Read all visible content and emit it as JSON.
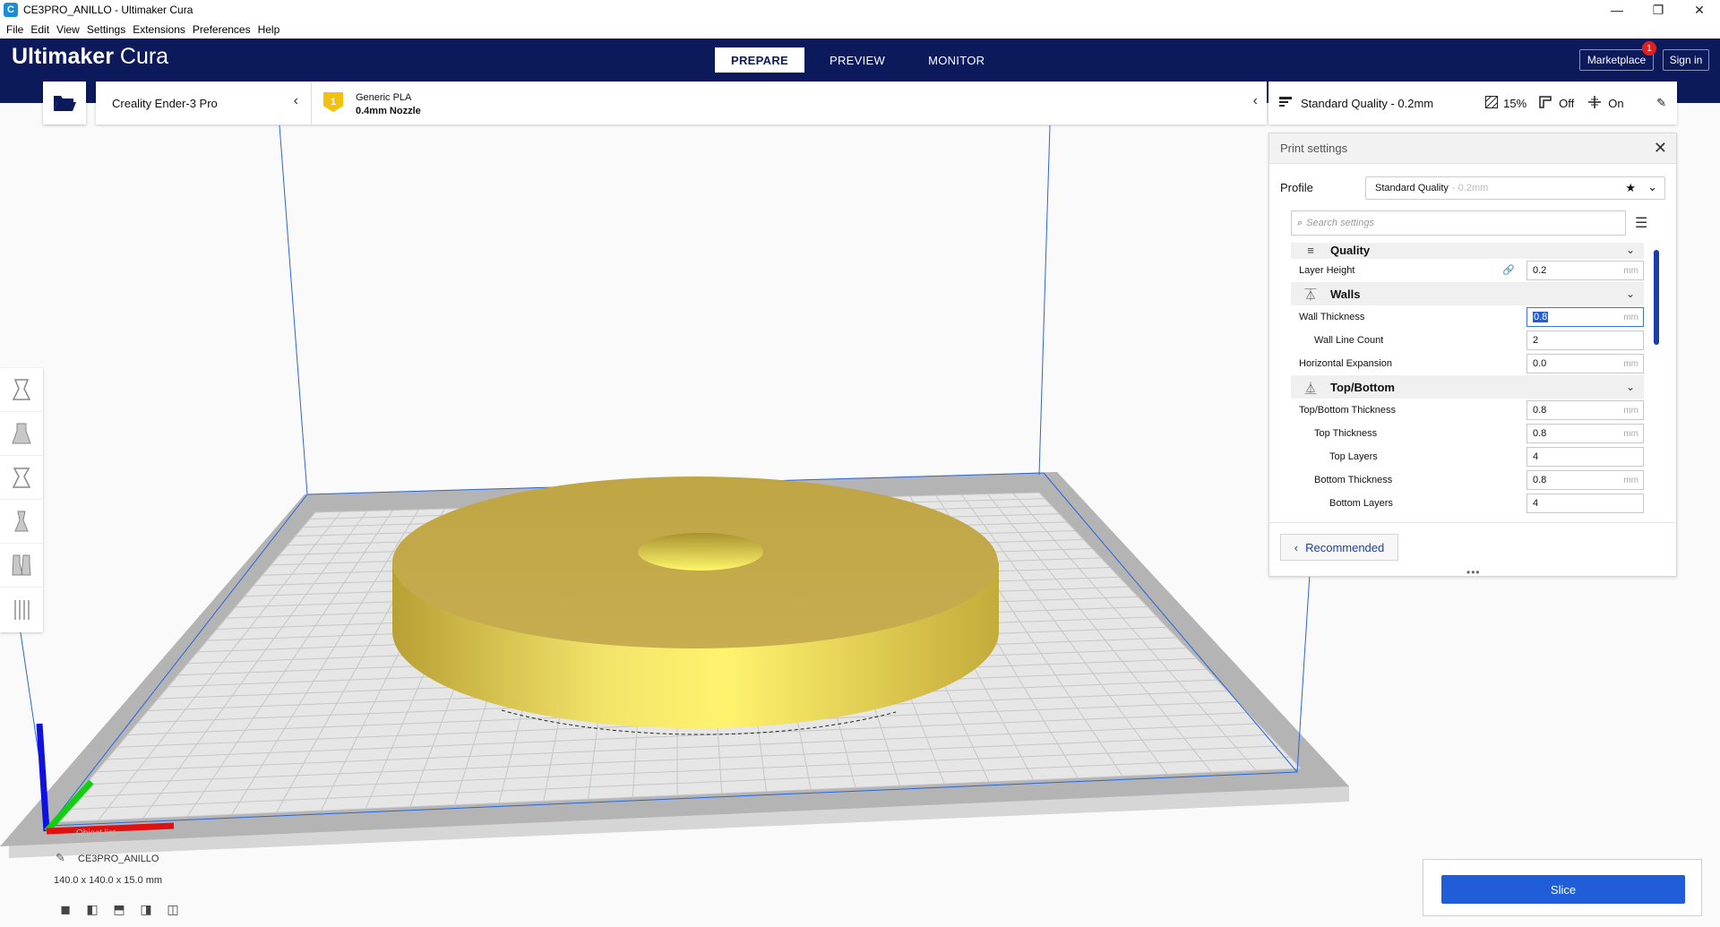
{
  "window": {
    "title": "CE3PRO_ANILLO - Ultimaker Cura",
    "app_icon": "C",
    "minimize": "—",
    "maximize": "❐",
    "close": "✕"
  },
  "menu": [
    "File",
    "Edit",
    "View",
    "Settings",
    "Extensions",
    "Preferences",
    "Help"
  ],
  "header": {
    "brand_bold": "Ultimaker",
    "brand_rest": " Cura",
    "tabs": [
      {
        "label": "PREPARE",
        "active": true
      },
      {
        "label": "PREVIEW",
        "active": false
      },
      {
        "label": "MONITOR",
        "active": false
      }
    ],
    "marketplace": "Marketplace",
    "marketplace_badge": "1",
    "signin": "Sign in"
  },
  "printer": {
    "name": "Creality Ender-3 Pro",
    "material_index": "1",
    "material": "Generic PLA",
    "nozzle": "0.4mm Nozzle"
  },
  "quality_bar": {
    "profile": "Standard Quality - 0.2mm",
    "infill": "15%",
    "support": "Off",
    "adhesion": "On"
  },
  "print_settings": {
    "title": "Print settings",
    "profile_label": "Profile",
    "profile_value": "Standard Quality",
    "profile_dim": "- 0.2mm",
    "search_placeholder": "Search settings",
    "categories": {
      "quality": "Quality",
      "walls": "Walls",
      "topbottom": "Top/Bottom"
    },
    "rows": {
      "layer_height": {
        "label": "Layer Height",
        "value": "0.2",
        "unit": "mm"
      },
      "wall_thickness": {
        "label": "Wall Thickness",
        "value": "0.8",
        "unit": "mm"
      },
      "wall_line_count": {
        "label": "Wall Line Count",
        "value": "2"
      },
      "horizontal_expansion": {
        "label": "Horizontal Expansion",
        "value": "0.0",
        "unit": "mm"
      },
      "topbottom_thickness": {
        "label": "Top/Bottom Thickness",
        "value": "0.8",
        "unit": "mm"
      },
      "top_thickness": {
        "label": "Top Thickness",
        "value": "0.8",
        "unit": "mm"
      },
      "top_layers": {
        "label": "Top Layers",
        "value": "4"
      },
      "bottom_thickness": {
        "label": "Bottom Thickness",
        "value": "0.8",
        "unit": "mm"
      },
      "bottom_layers": {
        "label": "Bottom Layers",
        "value": "4"
      }
    },
    "recommended": "Recommended"
  },
  "object": {
    "ghost_label": "Object list",
    "name": "CE3PRO_ANILLO",
    "dimensions": "140.0 x 140.0 x 15.0 mm"
  },
  "slice": {
    "label": "Slice"
  },
  "colors": {
    "header_bg": "#0c1a5c",
    "accent": "#1f5ed8",
    "model": "#e8d25a",
    "bed_grid": "#c8c8c8"
  }
}
